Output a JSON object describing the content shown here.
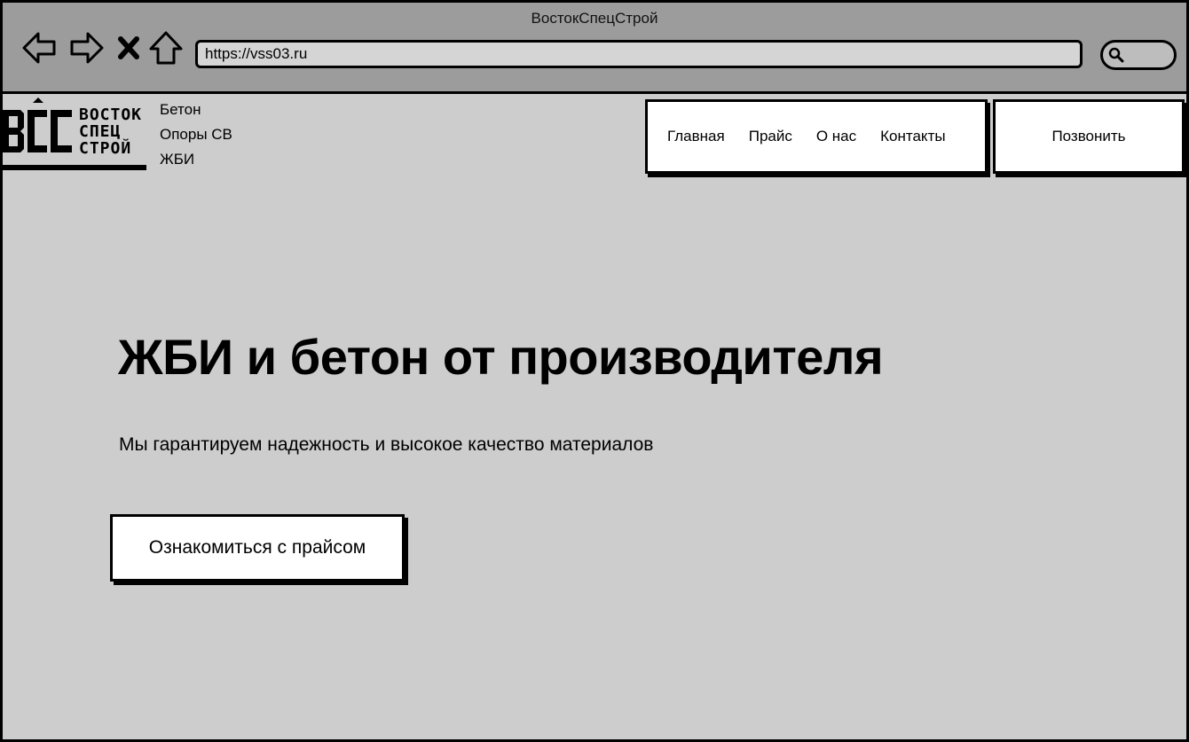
{
  "browser": {
    "window_title": "ВостокСпецСтрой",
    "url": "https://vss03.ru",
    "nav_icons": [
      "back-arrow-icon",
      "forward-arrow-icon",
      "close-icon",
      "home-icon"
    ],
    "search_icon": "search-icon"
  },
  "header": {
    "logo": {
      "line1": "ВОСТОК",
      "line2": "СПЕЦ",
      "line3": "СТРОЙ"
    },
    "side_links": [
      "Бетон",
      "Опоры СВ",
      "ЖБИ"
    ],
    "menu": [
      "Главная",
      "Прайс",
      "О нас",
      "Контакты"
    ],
    "call_button": "Позвонить"
  },
  "hero": {
    "title": "ЖБИ и бетон от производителя",
    "subtitle": "Мы гарантируем надежность и высокое качество материалов",
    "cta": "Ознакомиться с прайсом"
  }
}
